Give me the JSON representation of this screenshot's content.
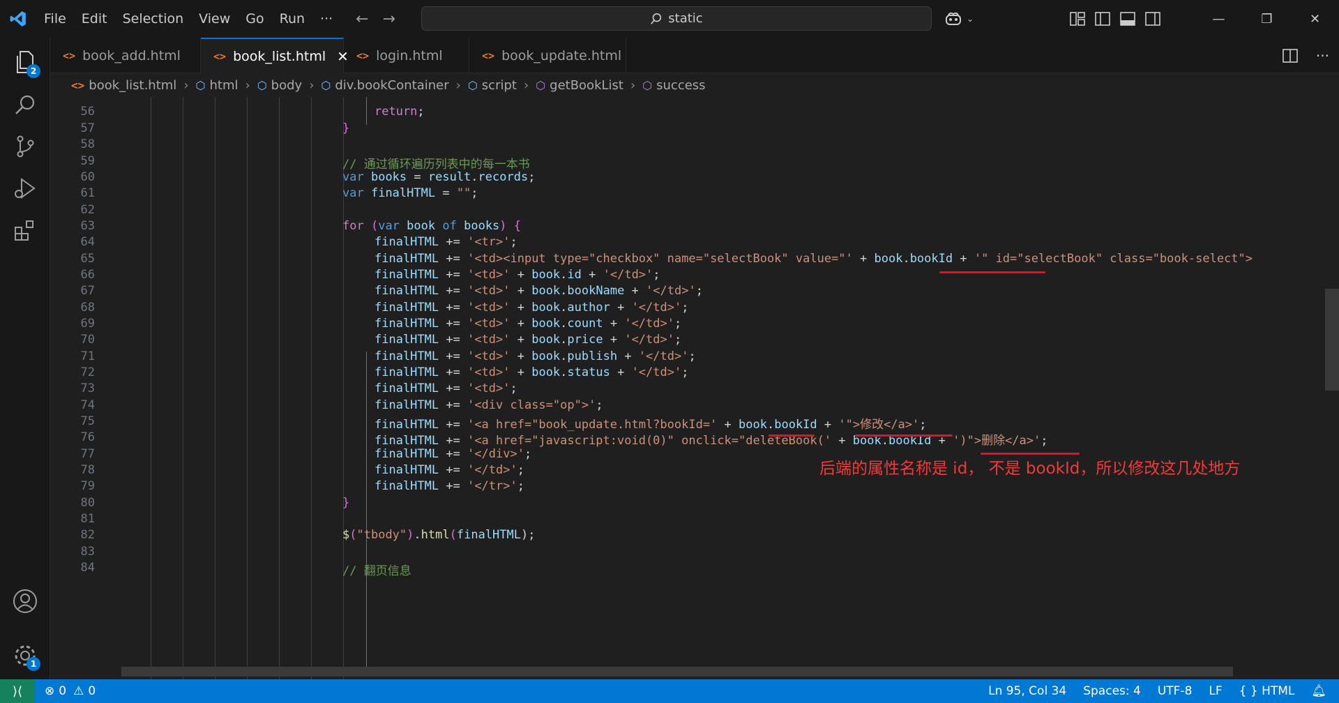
{
  "menu": [
    "File",
    "Edit",
    "Selection",
    "View",
    "Go",
    "Run",
    "···"
  ],
  "search": {
    "text": "static"
  },
  "activity": {
    "explorer_badge": "2",
    "settings_badge": "1"
  },
  "tabs": [
    {
      "label": "book_add.html",
      "state": "normal"
    },
    {
      "label": "book_list.html",
      "state": "active"
    },
    {
      "label": "login.html",
      "state": "modified"
    },
    {
      "label": "book_update.html",
      "state": "modified"
    }
  ],
  "breadcrumb": [
    "book_list.html",
    "html",
    "body",
    "div.bookContainer",
    "script",
    "getBookList",
    "success"
  ],
  "code_lines": [
    {
      "n": "56"
    },
    {
      "n": "57"
    },
    {
      "n": "58"
    },
    {
      "n": "59"
    },
    {
      "n": "60"
    },
    {
      "n": "61"
    },
    {
      "n": "62"
    },
    {
      "n": "63"
    },
    {
      "n": "64"
    },
    {
      "n": "65"
    },
    {
      "n": "66"
    },
    {
      "n": "67"
    },
    {
      "n": "68"
    },
    {
      "n": "69"
    },
    {
      "n": "70"
    },
    {
      "n": "71"
    },
    {
      "n": "72"
    },
    {
      "n": "73"
    },
    {
      "n": "74"
    },
    {
      "n": "75"
    },
    {
      "n": "76"
    },
    {
      "n": "77"
    },
    {
      "n": "78"
    },
    {
      "n": "79"
    },
    {
      "n": "80"
    },
    {
      "n": "81"
    },
    {
      "n": "82"
    },
    {
      "n": "83"
    },
    {
      "n": "84"
    }
  ],
  "code": {
    "l56_ret": "return",
    "l56_semi": ";",
    "l57": "}",
    "l59": "// 通过循环遍历列表中的每一本书",
    "l60_var": "var",
    "l60_books": "books",
    "l60_eq": " = ",
    "l60_result": "result",
    "l60_dot": ".",
    "l60_records": "records",
    "l60_semi": ";",
    "l61_var": "var",
    "l61_name": "finalHTML",
    "l61_eq": " = ",
    "l61_str": "\"\"",
    "l61_semi": ";",
    "l63_for": "for",
    "l63_open": " (",
    "l63_var": "var",
    "l63_book": "book",
    "l63_of": "of",
    "l63_books": "books",
    "l63_close": ") {",
    "fh": "finalHTML",
    "pe": " += ",
    "semi": ";",
    "plus": " + ",
    "book": "book",
    "dot": ".",
    "l64_s": "'<tr>'",
    "l65_s1": "'<td><input type=\"checkbox\" name=\"selectBook\" value=\"'",
    "l65_p": "bookId",
    "l65_s2": "'\" id=\"selectBook\" class=\"book-select\">",
    "td_open": "'<td>'",
    "td_close": "'</td>'",
    "l66_p": "id",
    "l67_p": "bookName",
    "l68_p": "author",
    "l69_p": "count",
    "l70_p": "price",
    "l71_p": "publish",
    "l72_p": "status",
    "l73_s": "'<td>'",
    "l74_s": "'<div class=\"op\">'",
    "l75_s1": "'<a href=\"book_update.html?bookId='",
    "l75_p": "bookId",
    "l75_s2": "'\">修改</a>'",
    "l76_s1": "'<a href=\"javascript:void(0)\" onclick=\"deleteBook('",
    "l76_p": "bookId",
    "l76_s2": "')\">删除</a>'",
    "l77_s": "'</div>'",
    "l78_s": "'</td>'",
    "l79_s": "'</tr>'",
    "l80": "}",
    "l82_dollar": "$",
    "l82_open": "(",
    "l82_str": "\"tbody\"",
    "l82_close": ")",
    "l82_dot": ".",
    "l82_html": "html",
    "l82_arg": "finalHTML",
    "l82_end": ");",
    "l84": "// 翻页信息"
  },
  "annotation": "后端的属性名称是 id， 不是 bookId，所以修改这几处地方",
  "status": {
    "errors": "0",
    "warnings": "0",
    "position": "Ln 95, Col 34",
    "spaces": "Spaces: 4",
    "encoding": "UTF-8",
    "eol": "LF",
    "language": "HTML"
  },
  "colors": {
    "accent": "#0078d4",
    "annotation": "#e81123",
    "remote": "#16825d"
  }
}
